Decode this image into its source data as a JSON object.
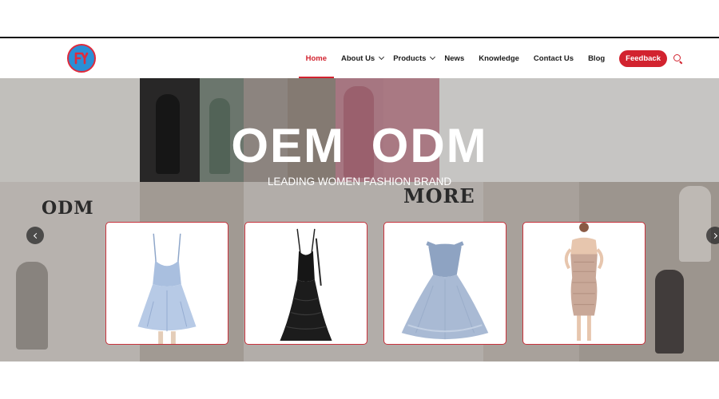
{
  "header": {
    "logo_icon": "brand-logo-icon",
    "nav": [
      {
        "label": "Home",
        "active": true,
        "has_dropdown": false
      },
      {
        "label": "About Us",
        "active": false,
        "has_dropdown": true
      },
      {
        "label": "Products",
        "active": false,
        "has_dropdown": true
      },
      {
        "label": "News",
        "active": false,
        "has_dropdown": false
      },
      {
        "label": "Knowledge",
        "active": false,
        "has_dropdown": false
      },
      {
        "label": "Contact Us",
        "active": false,
        "has_dropdown": false
      },
      {
        "label": "Blog",
        "active": false,
        "has_dropdown": false
      }
    ],
    "feedback_label": "Feedback",
    "search_icon": "search-icon"
  },
  "hero": {
    "title": "OEM  ODM",
    "subtitle": "LEADING WOMEN FASHION BRAND",
    "background_left_word": "ODM",
    "background_right_word": "MORE",
    "prev_icon": "chevron-left-icon",
    "next_icon": "chevron-right-icon"
  },
  "products": [
    {
      "icon": "light-blue-mini-dress-image"
    },
    {
      "icon": "black-sequin-gown-image"
    },
    {
      "icon": "blue-ball-gown-image"
    },
    {
      "icon": "rose-gold-sequin-dress-image"
    }
  ],
  "colors": {
    "accent": "#d2232f",
    "nav_text": "#1a1a1a",
    "logo_blue": "#2a8fd6"
  }
}
